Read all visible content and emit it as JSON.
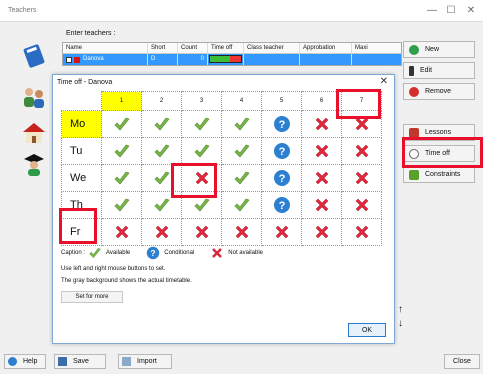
{
  "window": {
    "title": "Teachers",
    "minimize": "—",
    "maximize": "☐",
    "close": "✕"
  },
  "teachers_panel": {
    "enter_label": "Enter teachers :",
    "columns": [
      "Name",
      "Short",
      "Count",
      "Time off",
      "Class teacher",
      "Approbation",
      "Maxi"
    ],
    "rows": [
      {
        "name": "Danova",
        "short": "D",
        "count": "0"
      }
    ]
  },
  "right_buttons": {
    "new": "New",
    "edit": "Edit",
    "remove": "Remove",
    "lessons": "Lessons",
    "time_off": "Time off",
    "constraints": "Constraints"
  },
  "bottom_buttons": {
    "help": "Help",
    "save": "Save",
    "import": "Import",
    "close": "Close"
  },
  "dialog": {
    "title": "Time off - Danova",
    "close": "✕",
    "periods": [
      "1",
      "2",
      "3",
      "4",
      "5",
      "6",
      "7"
    ],
    "days": [
      "Mo",
      "Tu",
      "We",
      "Th",
      "Fr"
    ],
    "grid": [
      [
        "check",
        "check",
        "check",
        "check",
        "question",
        "cross",
        "cross"
      ],
      [
        "check",
        "check",
        "check",
        "check",
        "question",
        "cross",
        "cross"
      ],
      [
        "check",
        "check",
        "cross",
        "check",
        "question",
        "cross",
        "cross"
      ],
      [
        "check",
        "check",
        "check",
        "check",
        "question",
        "cross",
        "cross"
      ],
      [
        "cross",
        "cross",
        "cross",
        "cross",
        "cross",
        "cross",
        "cross"
      ]
    ],
    "caption_label": "Caption :",
    "legend": {
      "available": "Available",
      "conditional": "Conditional",
      "not_available": "Not available"
    },
    "help_line1": "Use left and right mouse buttons to set.",
    "help_line2": "The gray background shows the actual timetable.",
    "set_for_more": "Set for more",
    "ok": "OK"
  },
  "colors": {
    "highlight_yellow": "#ffff00",
    "selection_blue": "#3399ff",
    "annotation_red": "#e8102a",
    "check_green": "#7ab648",
    "cross_red": "#e0283c",
    "question_blue": "#2d7fd0"
  },
  "arrows": {
    "up": "↑",
    "down": "↓"
  }
}
